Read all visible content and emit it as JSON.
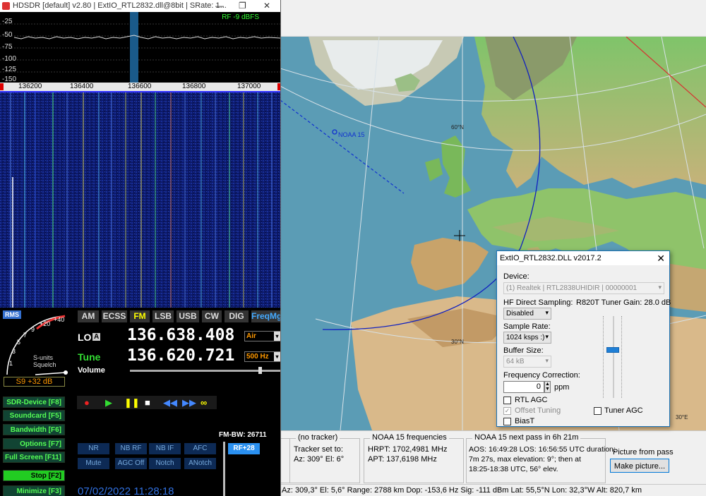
{
  "hdsdr": {
    "title": "HDSDR  [default]  v2.80  |  ExtIO_RTL2832.dll@8bit  |  SRate: 1...",
    "spectrum_levels": [
      "-25",
      "-50",
      "-75",
      "-100",
      "-125",
      "-150"
    ],
    "rf_level": "RF  -9 dBFS",
    "freq_axis": [
      "136200",
      "136400",
      "136600",
      "136800",
      "137000"
    ],
    "smeter": {
      "rms_label": "RMS",
      "scale_labels": [
        "1",
        "3",
        "5",
        "7",
        "9",
        "+20",
        "+40"
      ],
      "squelch_label_1": "S-units",
      "squelch_label_2": "Squelch",
      "reading": "S9 +32 dB"
    },
    "modes": [
      "AM",
      "ECSS",
      "FM",
      "LSB",
      "USB",
      "CW",
      "DIG",
      "FreqMgr"
    ],
    "active_mode": "FM",
    "lo": {
      "label": "LO",
      "sub": "A",
      "value": "136.638.408",
      "band": "Air"
    },
    "tune": {
      "label": "Tune",
      "value": "136.620.721",
      "step": "500 Hz"
    },
    "volume_label": "Volume",
    "side_buttons": [
      {
        "label": "SDR-Device  [F8]"
      },
      {
        "label": "Soundcard  [F5]"
      },
      {
        "label": "Bandwidth  [F6]"
      },
      {
        "label": "Options  [F7]"
      },
      {
        "label": "Full Screen  [F11]"
      },
      {
        "label": "Stop  [F2]"
      },
      {
        "label": "Minimize  [F3]"
      }
    ],
    "fm_bw": "FM-BW: 26711",
    "dsp_row1": [
      "NR",
      "NB RF",
      "NB IF",
      "AFC"
    ],
    "dsp_row2": [
      "Mute",
      "AGC Off",
      "Notch",
      "ANotch"
    ],
    "rf_boost": "RF+28",
    "datetime": "07/02/2022  11:28:18"
  },
  "map": {
    "satellite_label": "NOAA 15",
    "lat_60": "60°N",
    "lat_30": "30°N",
    "lon_30e": "30°E"
  },
  "orbitron": {
    "tracker": {
      "title": "(no tracker)",
      "line1": "Tracker set to:",
      "line2": "Az: 309°  El: 6°"
    },
    "freqs": {
      "title": "NOAA 15 frequencies",
      "line1": "HRPT:  1702,4981 MHz",
      "line2": "APT:  137,6198 MHz"
    },
    "next_pass": {
      "title": "NOAA 15 next pass in 6h 21m",
      "line1": "AOS: 16:49:28  LOS: 16:56:55 UTC  duration:",
      "line2": "7m 27s,  max elevation: 9°;  then at",
      "line3": "18:25-18:38 UTC, 56° elev."
    },
    "picture_label": "Picture from pass",
    "make_picture": "Make picture...",
    "status": "Az: 309,3°  El: 5,6°  Range: 2788 km  Dop: -153,6 Hz Sig: -111 dBm Lat: 55,5°N  Lon: 32,3°W  Alt: 820,7 km"
  },
  "extio": {
    "title": "ExtIO_RTL2832.DLL v2017.2",
    "device_label": "Device:",
    "device_value": "(1) Realtek | RTL2838UHIDIR | 00000001",
    "hf_label": "HF Direct Sampling:",
    "hf_value": "Disabled",
    "gain_label": "R820T Tuner Gain: 28.0  dB",
    "sample_rate_label": "Sample Rate:",
    "sample_rate_value": "1024 ksps :)",
    "buffer_label": "Buffer Size:",
    "buffer_value": "64 kB",
    "freq_corr_label": "Frequency Correction:",
    "freq_corr_value": "0",
    "ppm": "ppm",
    "rtl_agc": "RTL AGC",
    "offset_tuning": "Offset Tuning",
    "tuner_agc": "Tuner AGC",
    "biast": "BiasT"
  },
  "colors": {
    "accent": "#1a73b8",
    "fm_active": "#ffff00",
    "lo_freq": "#ffffff"
  }
}
